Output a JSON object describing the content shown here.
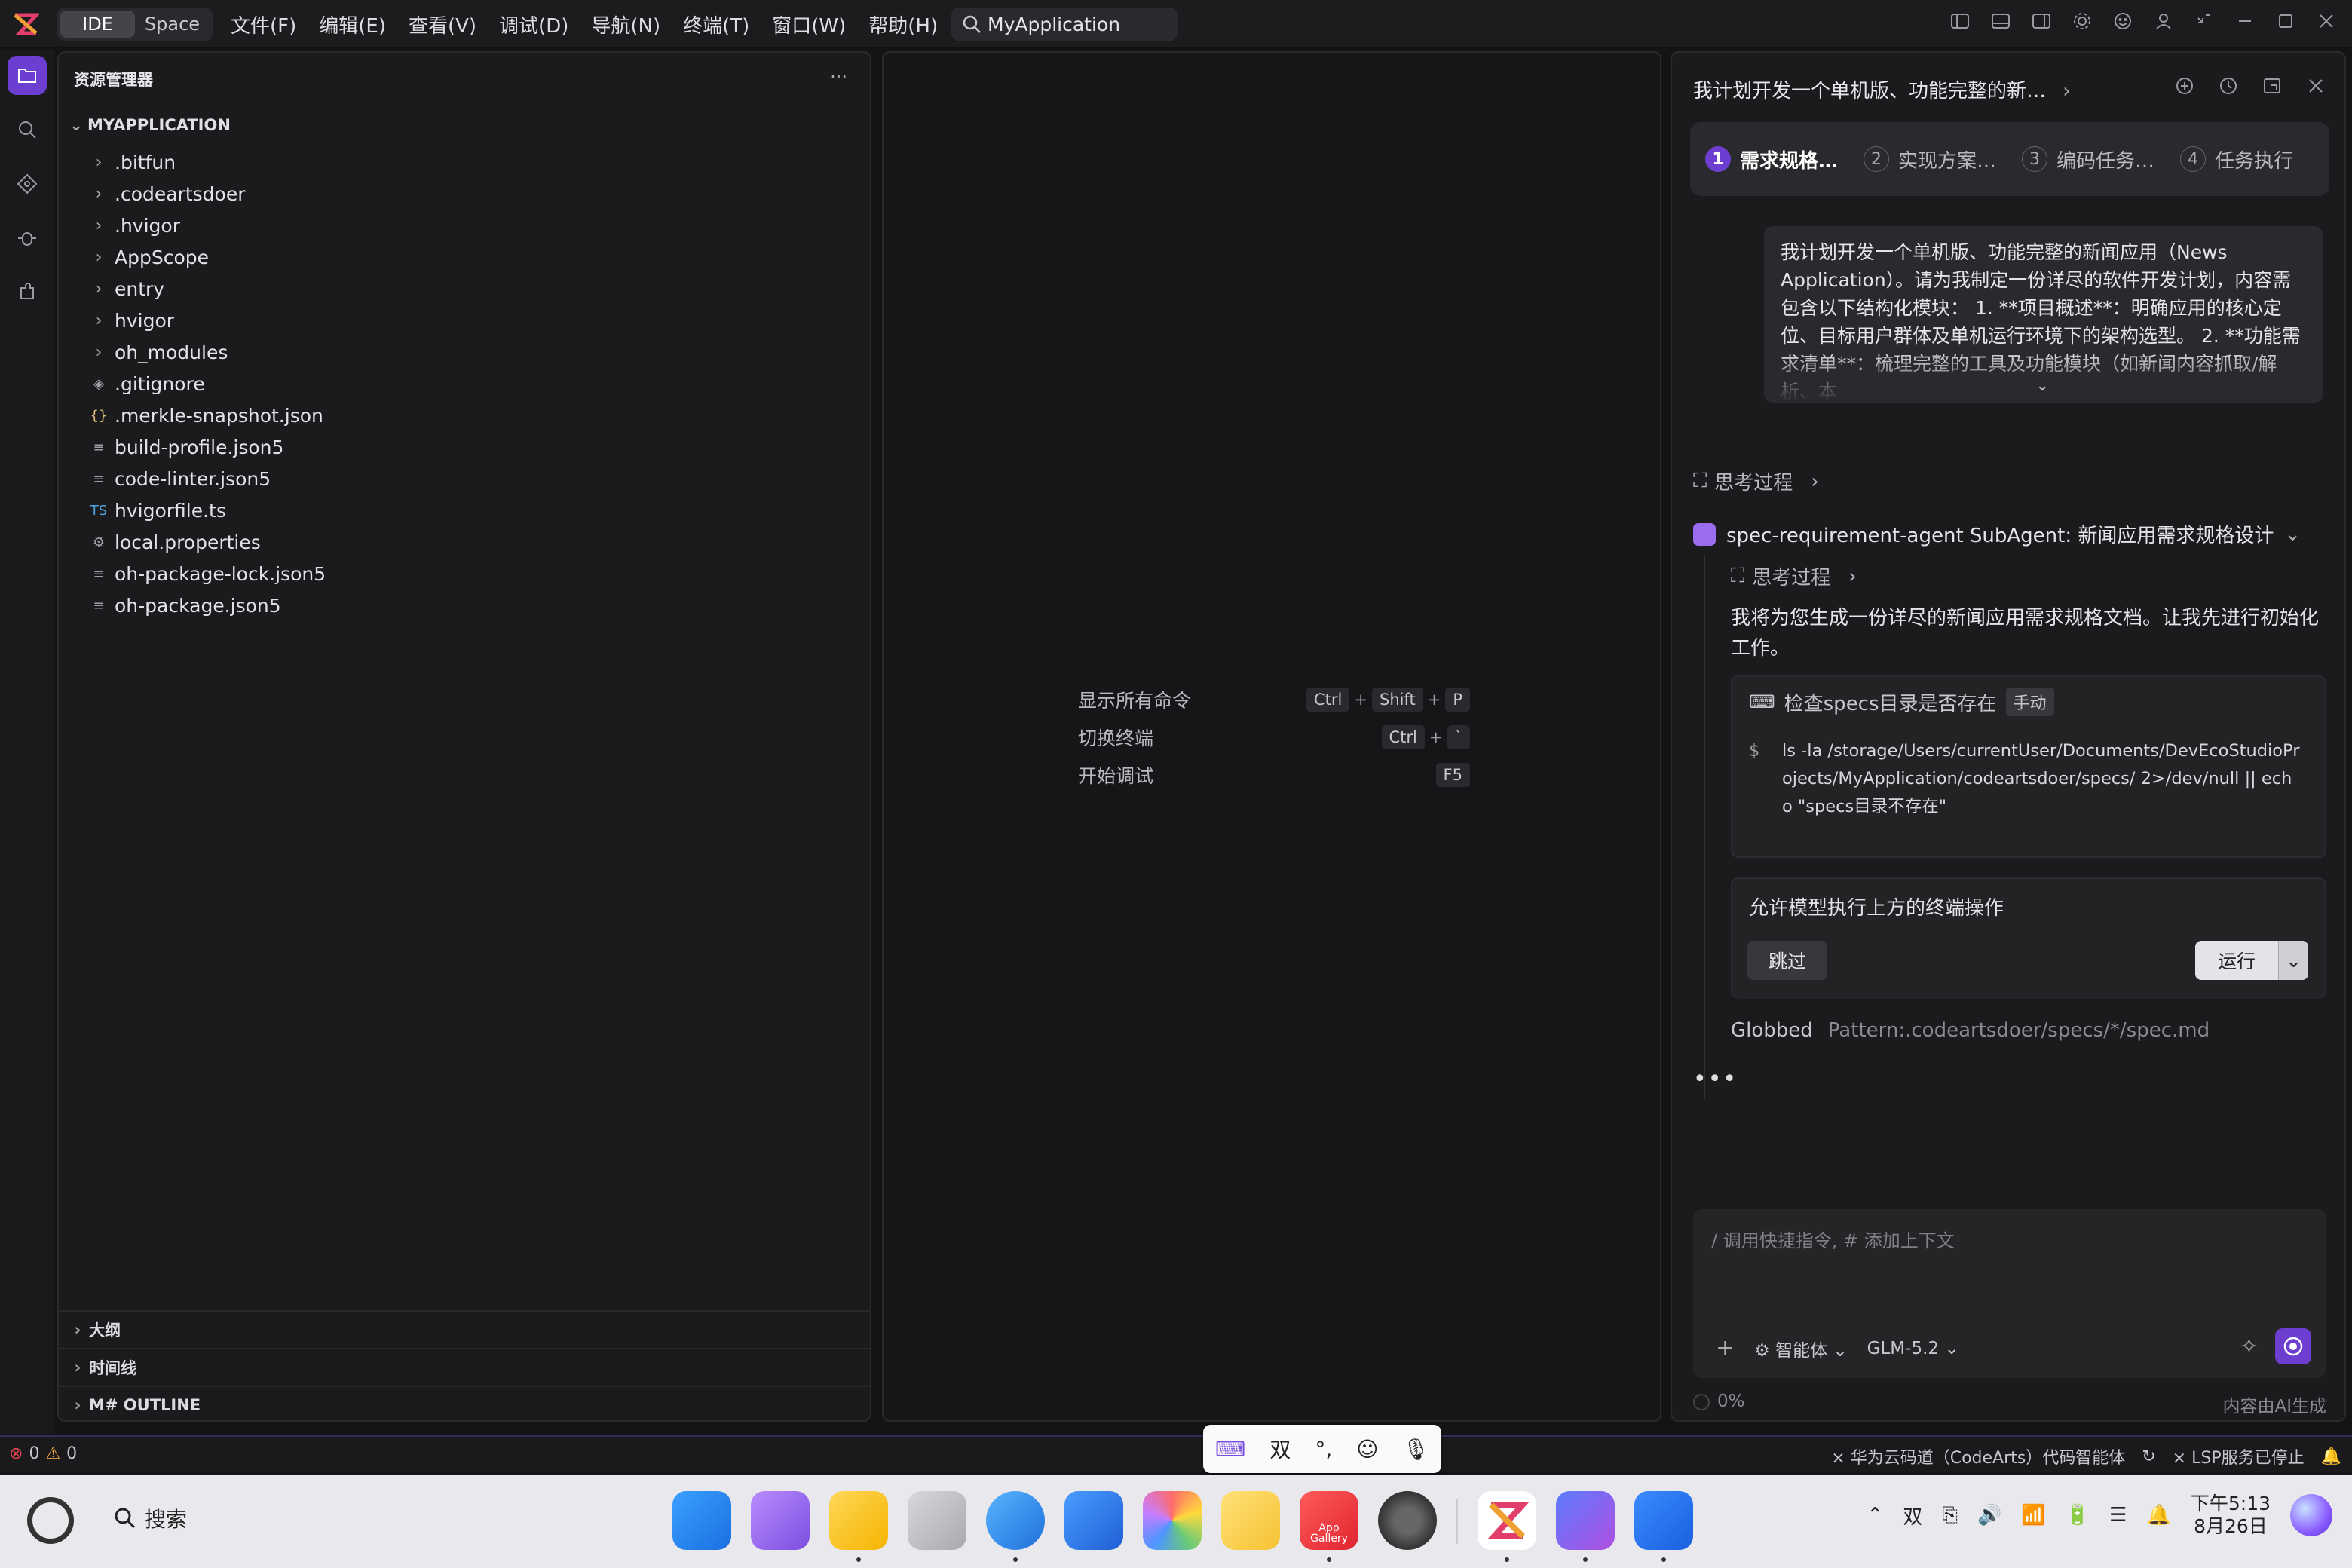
{
  "titlebar": {
    "mode_ide": "IDE",
    "mode_space": "Space",
    "menus": [
      "文件(F)",
      "编辑(E)",
      "查看(V)",
      "调试(D)",
      "导航(N)",
      "终端(T)",
      "窗口(W)",
      "帮助(H)"
    ],
    "search_text": "MyApplication"
  },
  "explorer": {
    "title": "资源管理器",
    "more": "···",
    "project": "MYAPPLICATION",
    "items": [
      {
        "name": ".bitfun",
        "kind": "folder"
      },
      {
        "name": ".codeartsdoer",
        "kind": "folder"
      },
      {
        "name": ".hvigor",
        "kind": "folder"
      },
      {
        "name": "AppScope",
        "kind": "folder"
      },
      {
        "name": "entry",
        "kind": "folder"
      },
      {
        "name": "hvigor",
        "kind": "folder"
      },
      {
        "name": "oh_modules",
        "kind": "folder"
      },
      {
        "name": ".gitignore",
        "kind": "git"
      },
      {
        "name": ".merkle-snapshot.json",
        "kind": "json"
      },
      {
        "name": "build-profile.json5",
        "kind": "text"
      },
      {
        "name": "code-linter.json5",
        "kind": "text"
      },
      {
        "name": "hvigorfile.ts",
        "kind": "ts"
      },
      {
        "name": "local.properties",
        "kind": "gear"
      },
      {
        "name": "oh-package-lock.json5",
        "kind": "text"
      },
      {
        "name": "oh-package.json5",
        "kind": "text"
      }
    ],
    "sections": [
      "大纲",
      "时间线",
      "M# OUTLINE"
    ]
  },
  "editor": {
    "shortcuts": [
      {
        "label": "显示所有命令",
        "keys": [
          "Ctrl",
          "+",
          "Shift",
          "+",
          "P"
        ]
      },
      {
        "label": "切换终端",
        "keys": [
          "Ctrl",
          "+",
          "`"
        ]
      },
      {
        "label": "开始调试",
        "keys": [
          "F5"
        ]
      }
    ]
  },
  "chat": {
    "title": "我计划开发一个单机版、功能完整的新…",
    "steps": [
      {
        "n": "1",
        "label": "需求规格…"
      },
      {
        "n": "2",
        "label": "实现方案…"
      },
      {
        "n": "3",
        "label": "编码任务…"
      },
      {
        "n": "4",
        "label": "任务执行"
      }
    ],
    "user_message": "我计划开发一个单机版、功能完整的新闻应用（News Application）。请为我制定一份详尽的软件开发计划，内容需包含以下结构化模块： 1. **项目概述**：明确应用的核心定位、目标用户群体及单机运行环境下的架构选型。 2. **功能需求清单**：梳理完整的工具及功能模块（如新闻内容抓取/解析、本",
    "thinking": "思考过程",
    "agent_label": "spec-requirement-agent SubAgent: 新闻应用需求规格设计",
    "agent_thinking": "思考过程",
    "reply": "我将为您生成一份详尽的新闻应用需求规格文档。让我先进行初始化工作。",
    "command": {
      "title": "检查specs目录是否存在",
      "tag": "手动",
      "prompt": "$",
      "text": "ls -la /storage/Users/currentUser/Documents/DevEcoStudioProjects/MyApplication/codeartsdoer/specs/ 2>/dev/null || echo \"specs目录不存在\""
    },
    "permission": {
      "title": "允许模型执行上方的终端操作",
      "skip": "跳过",
      "run": "运行"
    },
    "globbed": {
      "label": "Globbed",
      "pattern": "Pattern:.codeartsdoer/specs/*/spec.md"
    },
    "dots": "•••",
    "input_placeholder": "/ 调用快捷指令, # 添加上下文",
    "agent_mode": "智能体",
    "model": "GLM-5.2",
    "progress": "0%",
    "disclaimer": "内容由AI生成"
  },
  "statusbar": {
    "errors": "0",
    "warnings": "0",
    "agent": "华为云码道（CodeArts）代码智能体",
    "lsp": "LSP服务已停止"
  },
  "ime": {
    "mode": "双",
    "punct": "°,"
  },
  "taskbar": {
    "search_label": "搜索",
    "app_gallery_label": "App Gallery",
    "tray_ime": "双",
    "time": "下午5:13",
    "date": "8月26日"
  },
  "colors": {
    "accent": "#6d3fd1",
    "background": "#141416",
    "panel": "#1b1b1d"
  }
}
